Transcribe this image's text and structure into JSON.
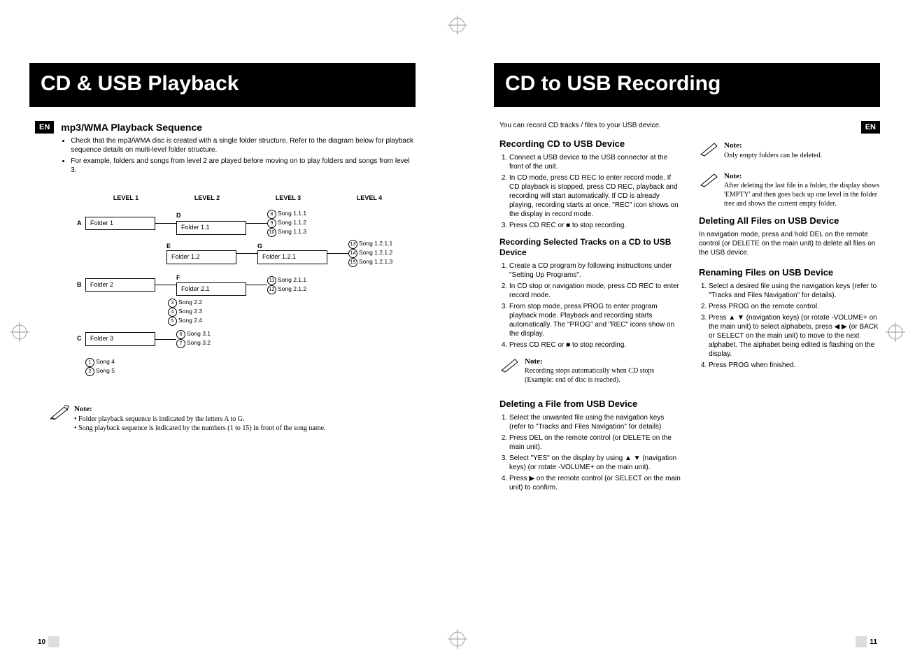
{
  "left": {
    "title": "CD & USB Playback",
    "lang_badge": "EN",
    "h2": "mp3/WMA Playback Sequence",
    "bullets": [
      "Check that the mp3/WMA disc is created with a single folder structure. Refer to the diagram below for playback sequence details on multi-level folder structure.",
      "For example, folders and songs from level 2 are played before moving on to play folders and songs from level 3."
    ],
    "levels": [
      "LEVEL 1",
      "LEVEL 2",
      "LEVEL 3",
      "LEVEL 4"
    ],
    "tree": {
      "A": "Folder 1",
      "D": "Folder 1.1",
      "songs_D": [
        "Song 1.1.1",
        "Song 1.1.2",
        "Song 1.1.3"
      ],
      "songs_D_nums": [
        "8",
        "9",
        "10"
      ],
      "E": "Folder 1.2",
      "G": "Folder 1.2.1",
      "songs_G": [
        "Song 1.2.1.1",
        "Song 1.2.1.2",
        "Song 1.2.1.3"
      ],
      "songs_G_nums": [
        "13",
        "14",
        "15"
      ],
      "B": "Folder 2",
      "F": "Folder 2.1",
      "songs_F": [
        "Song 2.1.1",
        "Song 2.1.2"
      ],
      "songs_F_nums": [
        "11",
        "12"
      ],
      "songs_B": [
        "Song 2.2",
        "Song 2.3",
        "Song 2.4"
      ],
      "songs_B_nums": [
        "3",
        "4",
        "5"
      ],
      "C": "Folder 3",
      "songs_C": [
        "Song 3.1",
        "Song 3.2"
      ],
      "songs_C_nums": [
        "6",
        "7"
      ],
      "songs_root": [
        "Song 4",
        "Song 5"
      ],
      "songs_root_nums": [
        "1",
        "2"
      ]
    },
    "note_title": "Note:",
    "note_lines": [
      "Folder playback sequence is indicated by the letters A to G.",
      "Song playback sequence is indicated by the numbers (1 to 15) in front of the song name."
    ],
    "page_num": "10"
  },
  "right": {
    "title": "CD to USB Recording",
    "lang_badge": "EN",
    "intro": "You can record CD tracks / files to your USB device.",
    "sec1": {
      "h3": "Recording CD to USB Device",
      "steps": [
        "Connect a USB device to the USB connector at the front of the unit.",
        "In CD mode, press CD REC to enter record mode. If CD playback is stopped, press CD REC, playback and recording will start automatically. If CD is already playing, recording starts at once. \"REC\" icon shows on the display in record mode.",
        "Press CD REC or  ■  to stop recording."
      ],
      "h4": "Recording Selected Tracks on a CD to USB Device",
      "steps2": [
        "Create a CD program by following instructions under \"Setting Up Programs\".",
        "In CD stop or navigation mode, press CD REC to enter record mode.",
        "From stop mode, press PROG to enter program playback mode. Playback and recording starts automatically. The \"PROG\" and \"REC\" icons show on the display.",
        "Press CD REC or  ■  to stop recording."
      ],
      "note_title": "Note:",
      "note_body": "Recording stops automatically when CD stops (Example: end of disc is reached)."
    },
    "sec2": {
      "h3": "Deleting a File from USB Device",
      "steps": [
        "Select the unwanted file using the navigation keys (refer to \"Tracks and Files Navigation\" for details)",
        "Press DEL on the remote control (or DELETE on the main unit).",
        "Select \"YES\" on the display by using ▲ ▼ (navigation keys) (or rotate -VOLUME+ on the main unit).",
        "Press ▶ on the remote control (or SELECT on the main unit) to confirm."
      ]
    },
    "col2": {
      "note1_title": "Note:",
      "note1_body": "Only empty folders can be deleted.",
      "note2_title": "Note:",
      "note2_body": "After deleting the last file in a folder, the display shows 'EMPTY' and then goes back up one level in the folder tree and shows the current empty folder.",
      "h3a": "Deleting All Files on USB Device",
      "p_a": "In navigation mode, press and hold DEL on the remote control (or DELETE on the main unit) to delete all files on the USB device.",
      "h3b": "Renaming Files on USB Device",
      "steps_b": [
        "Select a desired file using the navigation keys (refer to \"Tracks and Files Navigation\" for details).",
        "Press PROG on the remote control.",
        "Press ▲ ▼ (navigation keys) (or rotate -VOLUME+ on the main unit) to select alphabets, press ◀ ▶  (or BACK or SELECT on the main unit) to move to the next alphabet. The alphabet being edited is flashing on the display.",
        "Press PROG when finished."
      ]
    },
    "page_num": "11"
  }
}
